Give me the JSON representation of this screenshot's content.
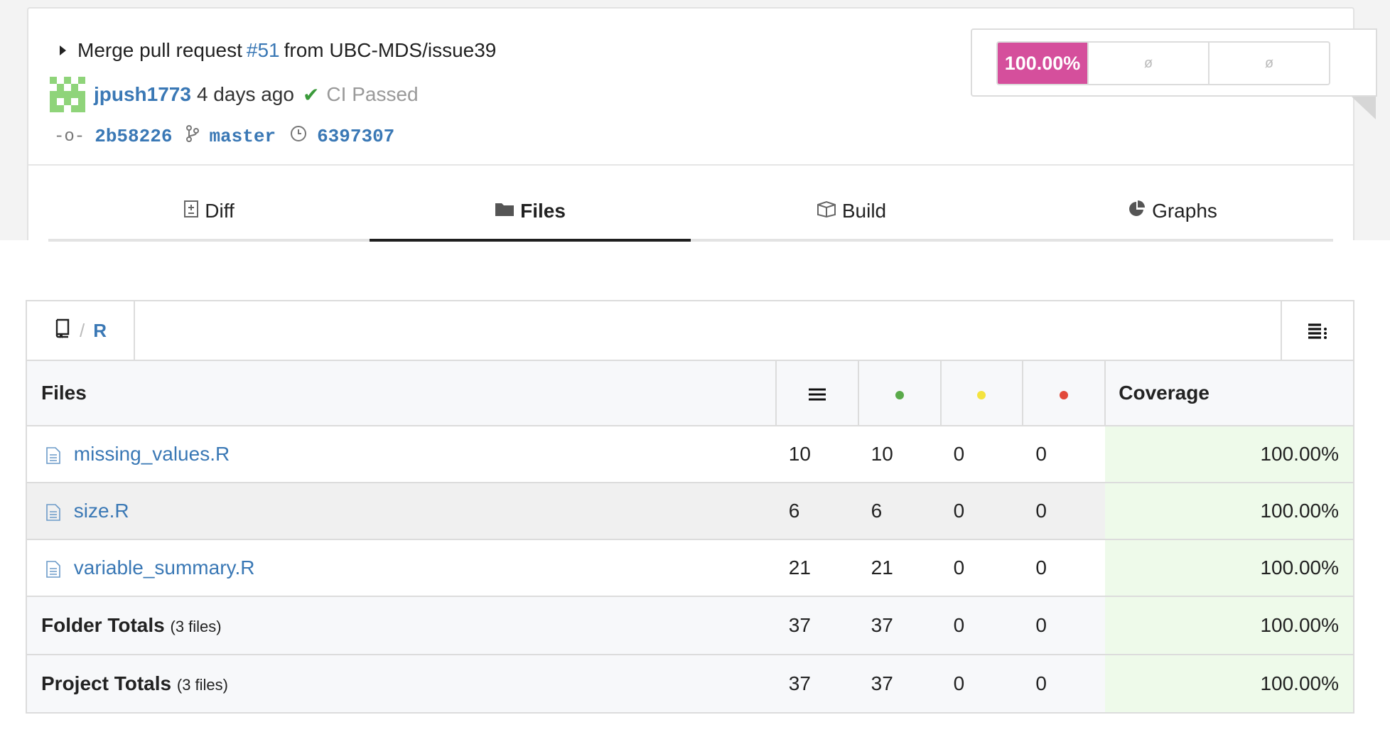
{
  "commit": {
    "message_prefix": "Merge pull request",
    "pr_link": "#51",
    "message_suffix": "from UBC-MDS/issue39",
    "author": "jpush1773",
    "time_ago": "4 days ago",
    "ci_status": "CI Passed",
    "sha": "2b58226",
    "branch": "master",
    "parent_sha": "6397307"
  },
  "badge": {
    "coverage": "100.00%",
    "change_1": "ø",
    "change_2": "ø",
    "color": "#d54f9c"
  },
  "tabs": [
    {
      "label": "Diff",
      "icon": "diff-icon"
    },
    {
      "label": "Files",
      "icon": "folder-icon",
      "active": true
    },
    {
      "label": "Build",
      "icon": "box-icon"
    },
    {
      "label": "Graphs",
      "icon": "pie-chart-icon"
    }
  ],
  "breadcrumb": {
    "separator": "/",
    "folder": "R"
  },
  "table": {
    "headers": {
      "files": "Files",
      "coverage": "Coverage"
    },
    "status_colors": {
      "hit": "#5aaa4a",
      "partial": "#f4e33e",
      "miss": "#e2493a"
    },
    "rows": [
      {
        "name": "missing_values.R",
        "lines": "10",
        "hits": "10",
        "partials": "0",
        "misses": "0",
        "coverage": "100.00%"
      },
      {
        "name": "size.R",
        "lines": "6",
        "hits": "6",
        "partials": "0",
        "misses": "0",
        "coverage": "100.00%"
      },
      {
        "name": "variable_summary.R",
        "lines": "21",
        "hits": "21",
        "partials": "0",
        "misses": "0",
        "coverage": "100.00%"
      }
    ],
    "folder_totals": {
      "label": "Folder Totals",
      "files": "(3 files)",
      "lines": "37",
      "hits": "37",
      "partials": "0",
      "misses": "0",
      "coverage": "100.00%"
    },
    "project_totals": {
      "label": "Project Totals",
      "files": "(3 files)",
      "lines": "37",
      "hits": "37",
      "partials": "0",
      "misses": "0",
      "coverage": "100.00%"
    }
  }
}
